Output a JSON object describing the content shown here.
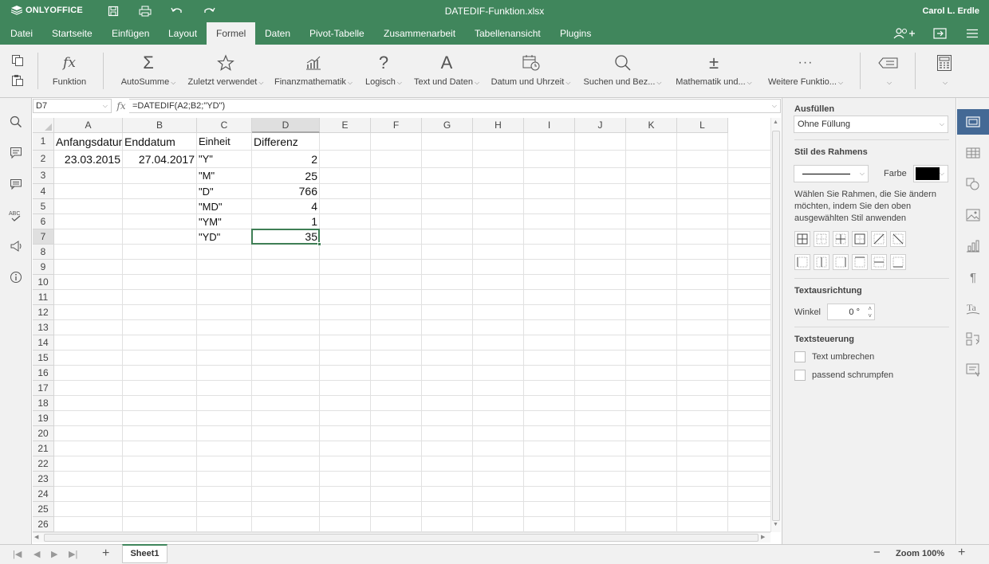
{
  "app": {
    "brand": "ONLYOFFICE",
    "doc_title": "DATEDIF-Funktion.xlsx",
    "user": "Carol L. Erdle",
    "accent": "#40865c"
  },
  "menu": {
    "tabs": [
      "Datei",
      "Startseite",
      "Einfügen",
      "Layout",
      "Formel",
      "Daten",
      "Pivot-Tabelle",
      "Zusammenarbeit",
      "Tabellenansicht",
      "Plugins"
    ],
    "active": "Formel"
  },
  "toolbar": {
    "funktion": "Funktion",
    "autosumme": "AutoSumme",
    "zuletzt": "Zuletzt verwendet",
    "finanz": "Finanzmathematik",
    "logisch": "Logisch",
    "text": "Text und Daten",
    "datum": "Datum und Uhrzeit",
    "suchen": "Suchen und Bez...",
    "mathe": "Mathematik und...",
    "weitere": "Weitere Funktio..."
  },
  "formula_bar": {
    "cell_ref": "D7",
    "fx": "fx",
    "formula": "=DATEDIF(A2;B2;\"YD\")"
  },
  "sheet": {
    "columns": [
      "A",
      "B",
      "C",
      "D",
      "E",
      "F",
      "G",
      "H",
      "I",
      "J",
      "K",
      "L"
    ],
    "selected_col": "D",
    "selected_row": "7",
    "rows": [
      "1",
      "2",
      "3",
      "4",
      "5",
      "6",
      "7",
      "8",
      "9",
      "10",
      "11",
      "12",
      "13",
      "14",
      "15",
      "16",
      "17",
      "18",
      "19",
      "20",
      "21",
      "22",
      "23",
      "24",
      "25",
      "26"
    ],
    "cells": {
      "A1": "Anfangsdatum",
      "B1": "Enddatum",
      "C1": "Einheit",
      "D1": "Differenz",
      "A2": "23.03.2015",
      "B2": "27.04.2017",
      "C2": "\"Y\"",
      "D2": "2",
      "C3": "\"M\"",
      "D3": "25",
      "C4": "\"D\"",
      "D4": "766",
      "C5": "\"MD\"",
      "D5": "4",
      "C6": "\"YM\"",
      "D6": "1",
      "C7": "\"YD\"",
      "D7": "35"
    }
  },
  "settings": {
    "fill_title": "Ausfüllen",
    "fill_value": "Ohne Füllung",
    "border_title": "Stil des Rahmens",
    "color_label": "Farbe",
    "border_color": "#000000",
    "border_hint": "Wählen Sie Rahmen, die Sie ändern möchten, indem Sie den oben ausgewählten Stil anwenden",
    "align_title": "Textausrichtung",
    "angle_label": "Winkel",
    "angle_value": "0 °",
    "control_title": "Textsteuerung",
    "wrap_label": "Text umbrechen",
    "shrink_label": "passend schrumpfen"
  },
  "status": {
    "sheet_tab": "Sheet1",
    "zoom": "Zoom 100%"
  }
}
